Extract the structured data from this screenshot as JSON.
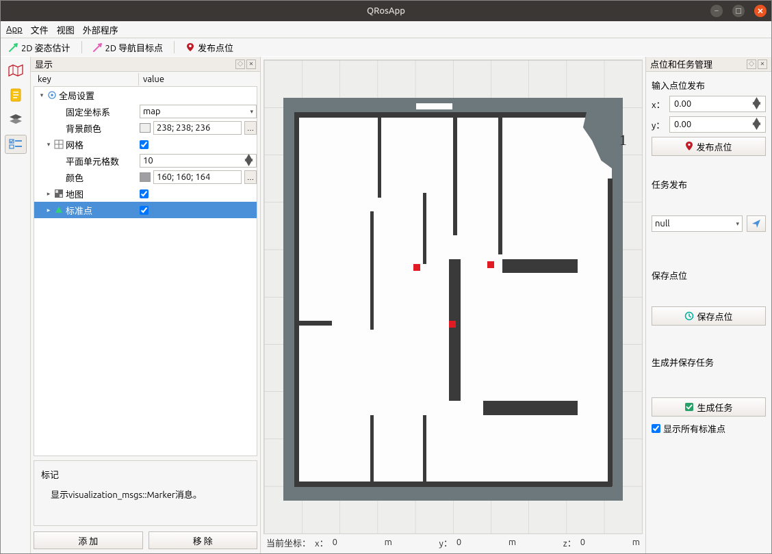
{
  "window": {
    "title": "QRosApp"
  },
  "menu": {
    "app": "App",
    "file": "文件",
    "view": "视图",
    "external": "外部程序"
  },
  "toolbar": {
    "pose_estimate": "2D 姿态估计",
    "nav_goal": "2D 导航目标点",
    "publish_point": "发布点位"
  },
  "display_dock": {
    "title": "显示",
    "columns": {
      "key": "key",
      "value": "value"
    },
    "tree": {
      "global_settings": {
        "label": "全局设置"
      },
      "fixed_frame": {
        "label": "固定坐标系",
        "value": "map"
      },
      "bg_color": {
        "label": "背景颜色",
        "value": "238; 238; 236",
        "swatch": "#eeeeec"
      },
      "grid": {
        "label": "网格",
        "checked": true
      },
      "plane_cells": {
        "label": "平面单元格数",
        "value": "10"
      },
      "grid_color": {
        "label": "颜色",
        "value": "160; 160; 164",
        "swatch": "#a0a0a4"
      },
      "map": {
        "label": "地图",
        "checked": true
      },
      "marker_points": {
        "label": "标准点",
        "checked": true
      }
    },
    "description": {
      "title": "标记",
      "body": "显示visualization_msgs::Marker消息。"
    },
    "buttons": {
      "add": "添 加",
      "remove": "移 除"
    }
  },
  "viewport": {
    "coord_label": "当前坐标：",
    "x_label": "x：",
    "x_value": "0",
    "x_unit": "m",
    "y_label": "y：",
    "y_value": "0",
    "y_unit": "m",
    "z_label": "z：",
    "z_value": "0",
    "z_unit": "m",
    "annotation_1": "1"
  },
  "right_dock": {
    "title": "点位和任务管理",
    "input_section": "输入点位发布",
    "x_label": "x：",
    "x_value": "0.00",
    "y_label": "y：",
    "y_value": "0.00",
    "publish_btn": "发布点位",
    "task_section": "任务发布",
    "task_selected": "null",
    "save_section": "保存点位",
    "save_btn": "保存点位",
    "gen_section": "生成并保存任务",
    "gen_btn": "生成任务",
    "show_all_checkbox": "显示所有标准点",
    "show_all_checked": true
  },
  "colors": {
    "accent_green": "#33d17a",
    "accent_pink": "#e362b6",
    "marker_red": "#e01b24",
    "pin_red": "#c01c28",
    "paper_blue": "#4a90d9",
    "task_green": "#26a269",
    "clock_teal": "#00b0a0"
  }
}
